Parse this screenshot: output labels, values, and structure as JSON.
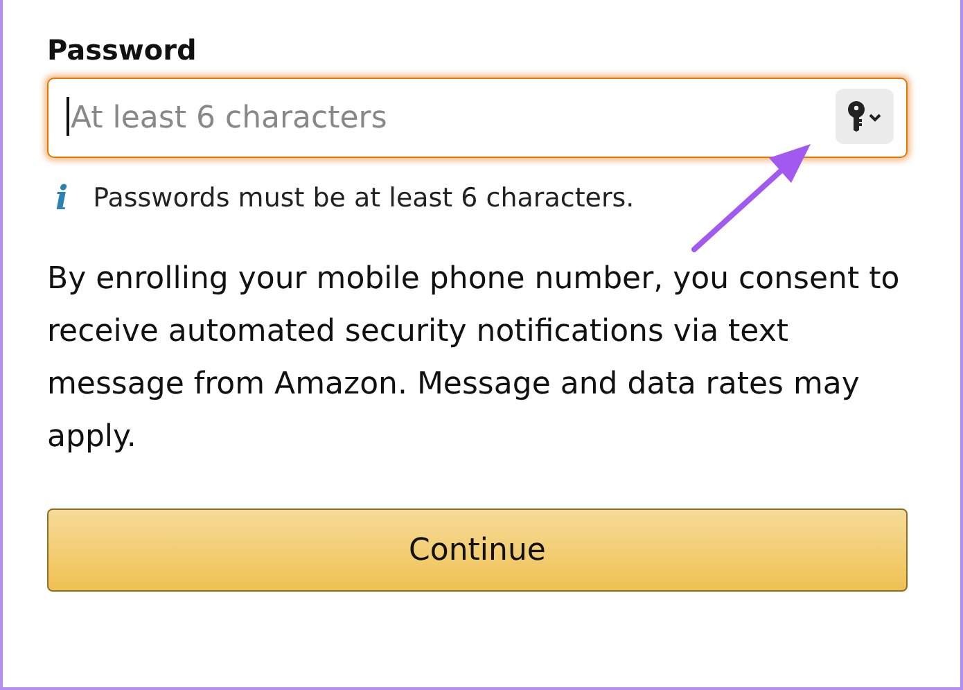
{
  "password_field": {
    "label": "Password",
    "placeholder": "At least 6 characters",
    "focused": true
  },
  "hint": {
    "icon": "i",
    "text": "Passwords must be at least 6 characters."
  },
  "consent_text": "By enrolling your mobile phone number, you consent to receive automated security notifications via text message from Amazon. Message and data rates may apply.",
  "buttons": [
    "Continue"
  ],
  "annotation": {
    "kind": "arrow"
  }
}
